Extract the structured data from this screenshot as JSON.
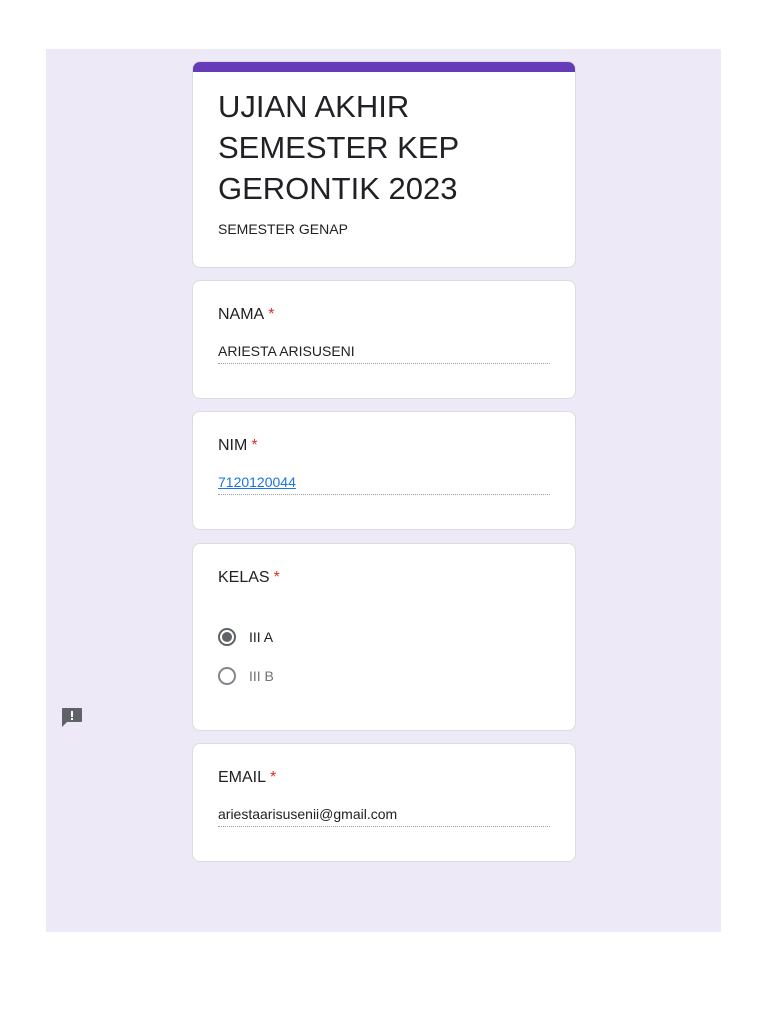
{
  "form": {
    "title": "UJIAN AKHIR SEMESTER KEP GERONTIK 2023",
    "description": "SEMESTER GENAP",
    "accent_color": "#673ab7",
    "background_color": "#ede9f6"
  },
  "questions": {
    "nama": {
      "label": "NAMA",
      "required_mark": "*",
      "value": "ARIESTA ARISUSENI"
    },
    "nim": {
      "label": "NIM",
      "required_mark": "*",
      "value": "7120120044"
    },
    "kelas": {
      "label": "KELAS",
      "required_mark": "*",
      "options": [
        {
          "label": "III A",
          "selected": true
        },
        {
          "label": "III B",
          "selected": false
        }
      ]
    },
    "email": {
      "label": "EMAIL",
      "required_mark": "*",
      "value": "ariestaarisusenii@gmail.com"
    }
  },
  "icons": {
    "feedback": "report-feedback-icon"
  }
}
